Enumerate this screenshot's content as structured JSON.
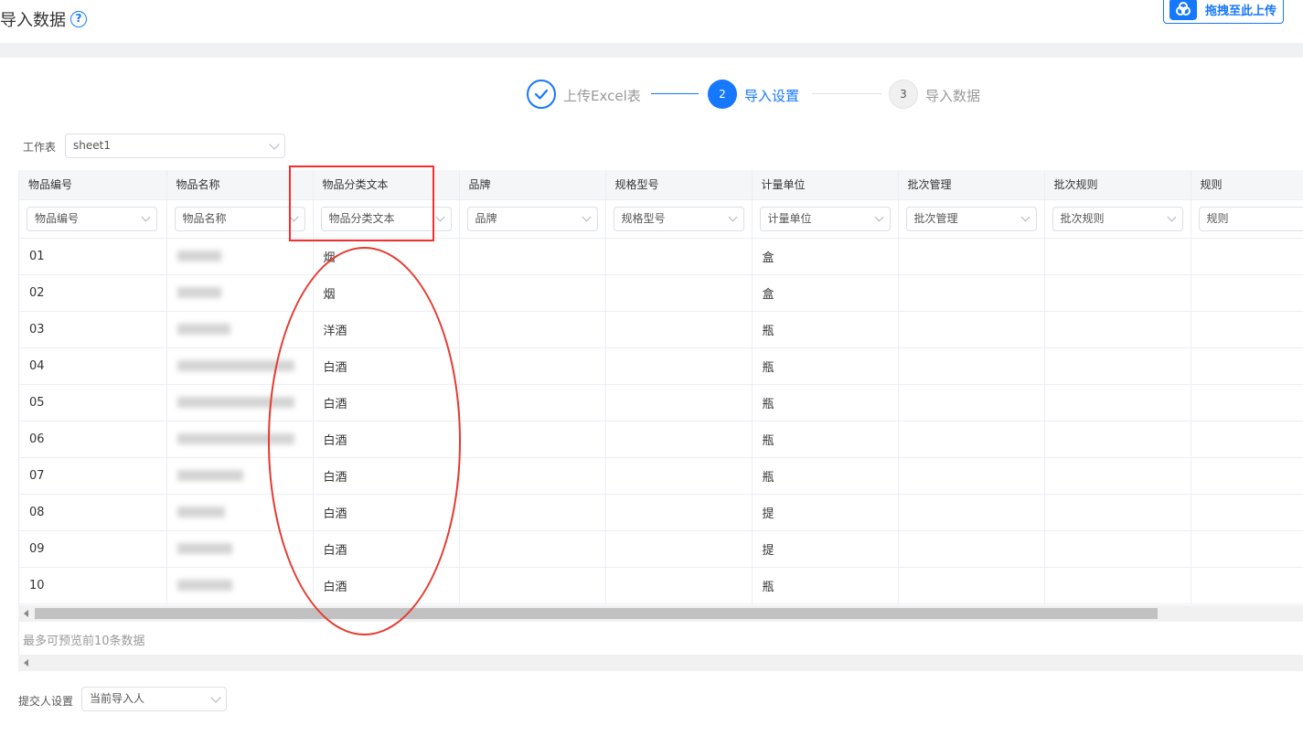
{
  "header": {
    "title": "导入数据",
    "help_icon": "?",
    "upload_button": "拖拽至此上传"
  },
  "steps": [
    {
      "label": "上传Excel表",
      "status": "done"
    },
    {
      "number": "2",
      "label": "导入设置",
      "status": "active"
    },
    {
      "number": "3",
      "label": "导入数据",
      "status": "pending"
    }
  ],
  "worksheet": {
    "label": "工作表",
    "value": "sheet1"
  },
  "columns": [
    "物品编号",
    "物品名称",
    "物品分类文本",
    "品牌",
    "规格型号",
    "计量单位",
    "批次管理",
    "批次规则",
    "规则"
  ],
  "mappings": [
    "物品编号",
    "物品名称",
    "物品分类文本",
    "品牌",
    "规格型号",
    "计量单位",
    "批次管理",
    "批次规则",
    "规则"
  ],
  "rows": [
    {
      "code": "01",
      "category": "烟",
      "unit": "盒"
    },
    {
      "code": "02",
      "category": "烟",
      "unit": "盒"
    },
    {
      "code": "03",
      "category": "洋酒",
      "unit": "瓶"
    },
    {
      "code": "04",
      "category": "白酒",
      "unit": "瓶"
    },
    {
      "code": "05",
      "category": "白酒",
      "unit": "瓶"
    },
    {
      "code": "06",
      "category": "白酒",
      "unit": "瓶"
    },
    {
      "code": "07",
      "category": "白酒",
      "unit": "瓶"
    },
    {
      "code": "08",
      "category": "白酒",
      "unit": "提"
    },
    {
      "code": "09",
      "category": "白酒",
      "unit": "提"
    },
    {
      "code": "10",
      "category": "白酒",
      "unit": "瓶"
    }
  ],
  "preview_note": "最多可预览前10条数据",
  "submitter": {
    "label": "提交人设置",
    "value": "当前导入人"
  },
  "colors": {
    "accent": "#1677ff",
    "annotation": "#ff2b2b"
  }
}
